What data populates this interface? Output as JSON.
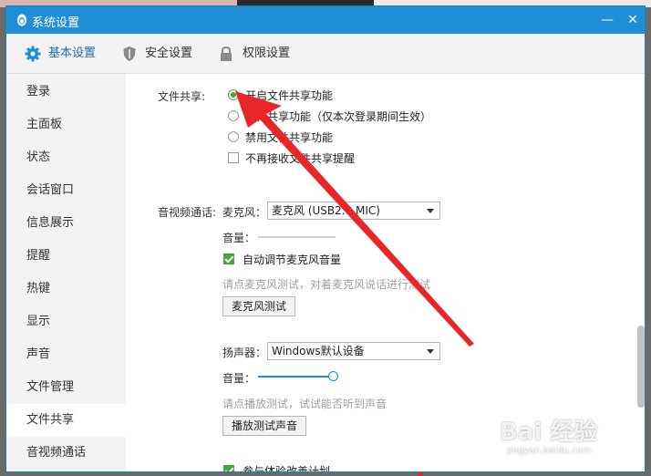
{
  "window": {
    "title": "系统设置",
    "minimize": "—",
    "close": "✕"
  },
  "tabs": [
    {
      "label": "基本设置",
      "icon": "gear-icon",
      "active": true
    },
    {
      "label": "安全设置",
      "icon": "shield-icon",
      "active": false
    },
    {
      "label": "权限设置",
      "icon": "lock-icon",
      "active": false
    }
  ],
  "sidebar": {
    "items": [
      {
        "label": "登录"
      },
      {
        "label": "主面板"
      },
      {
        "label": "状态"
      },
      {
        "label": "会话窗口"
      },
      {
        "label": "信息展示"
      },
      {
        "label": "提醒"
      },
      {
        "label": "热键"
      },
      {
        "label": "显示"
      },
      {
        "label": "声音"
      },
      {
        "label": "文件管理"
      },
      {
        "label": "文件共享",
        "active": true
      },
      {
        "label": "音视频通话"
      }
    ]
  },
  "file_share": {
    "section_label": "文件共享:",
    "options": [
      {
        "label": "开启文件共享功能",
        "checked": true
      },
      {
        "label": "文件共享功能（仅本次登录期间生效）",
        "checked": false
      },
      {
        "label": "禁用文件共享功能",
        "checked": false
      }
    ],
    "no_prompt": {
      "label": "不再接收文件共享提醒",
      "checked": false
    }
  },
  "av_call": {
    "section_label": "音视频通话:",
    "mic": {
      "label": "麦克风：",
      "device": "麦克风 (USB2.0 MIC)",
      "volume_label": "音量：",
      "volume": 0.0,
      "auto_adjust": {
        "label": "自动调节麦克风音量",
        "checked": true
      },
      "hint": "请点麦克风测试，对着麦克风说话进行测试",
      "test_button": "麦克风测试"
    },
    "speaker": {
      "label": "扬声器：",
      "device": "Windows默认设备",
      "volume_label": "音量：",
      "volume": 1.0,
      "hint": "请点播放测试，试试能否听到声音",
      "test_button": "播放测试声音"
    },
    "experience": {
      "label": "参与体验改善计划",
      "checked": true
    }
  },
  "watermark": {
    "main": "Bai 经验",
    "sub": "jingyan.baidu.com"
  },
  "colors": {
    "titlebar": "#1f8ed6",
    "accent_green": "#4aa53a",
    "arrow_red": "#e8262a"
  }
}
